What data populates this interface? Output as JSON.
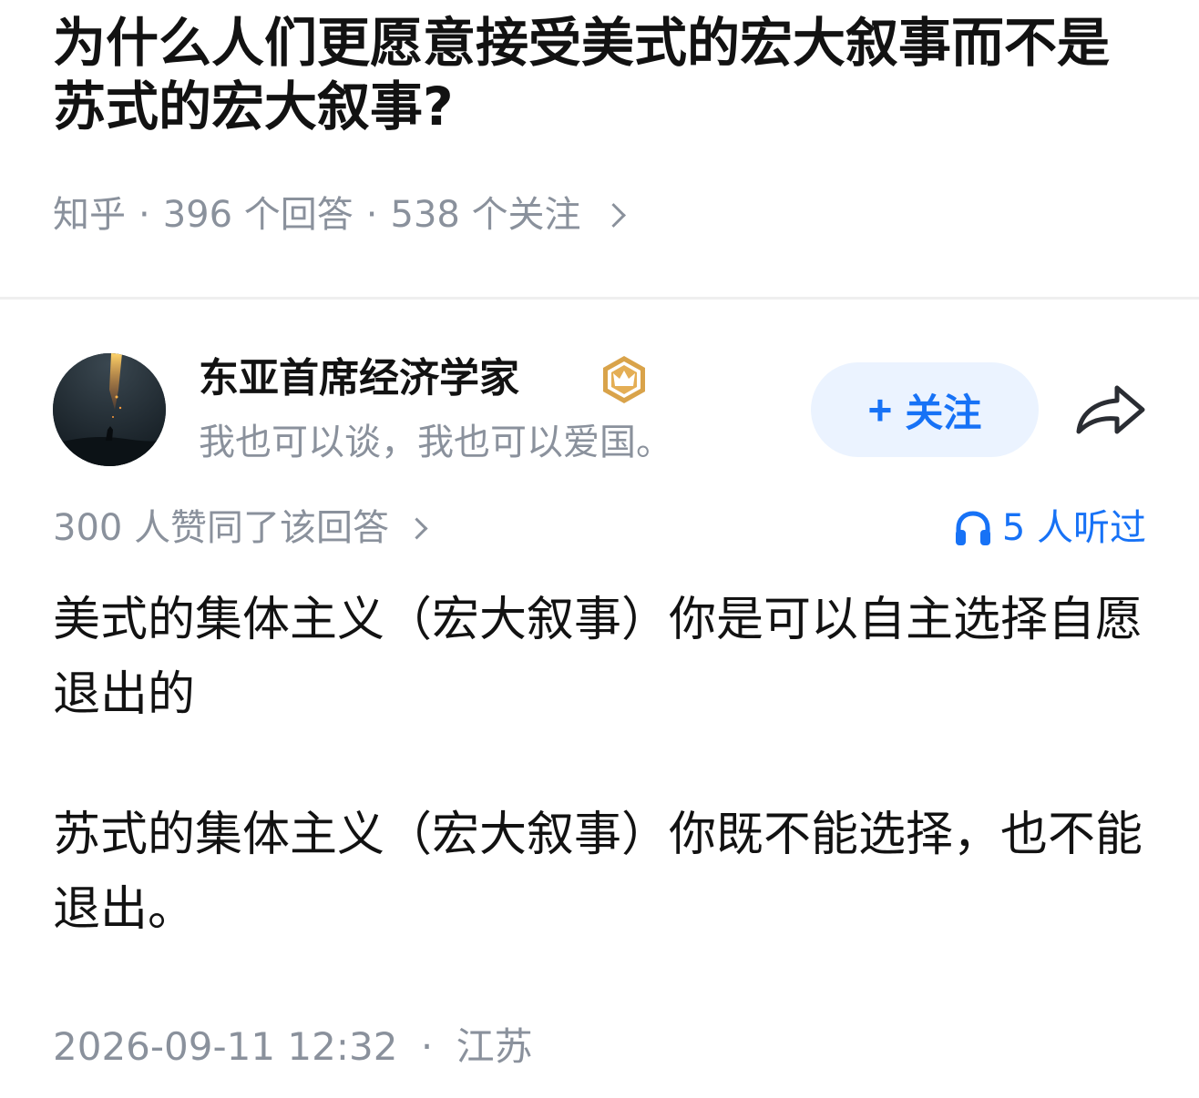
{
  "question": {
    "title": "为什么人们更愿意接受美式的宏大叙事而不是苏式的宏大叙事?",
    "source": "知乎",
    "answers_count": "396 个回答",
    "followers_count": "538 个关注"
  },
  "author": {
    "name": "东亚首席经济学家",
    "bio": "我也可以谈，我也可以爱国。",
    "badge_icon": "crown-badge-icon"
  },
  "actions": {
    "follow_plus": "+",
    "follow_label": "关注"
  },
  "stats": {
    "likes": "300 人赞同了该回答",
    "listened": "5 人听过"
  },
  "answer": {
    "paragraphs": [
      "美式的集体主义（宏大叙事）你是可以自主选择自愿退出的",
      "苏式的集体主义（宏大叙事）你既不能选择，也不能退出。"
    ],
    "date": "2026-09-11 12:32",
    "location": "江苏"
  },
  "colors": {
    "accent_blue": "#1772f6",
    "follow_bg": "#ebf3ff",
    "meta_gray": "#8a919c",
    "badge_gold": "#d9a34a"
  }
}
